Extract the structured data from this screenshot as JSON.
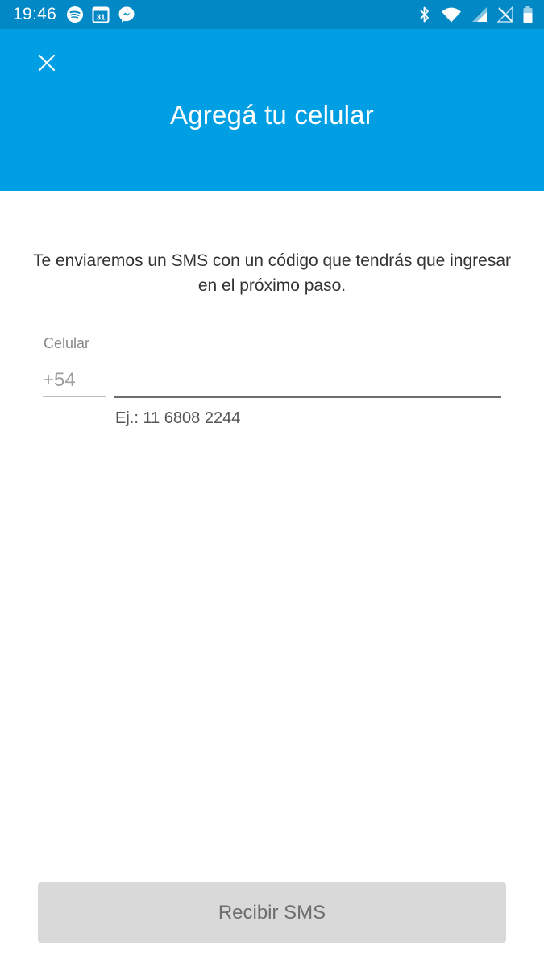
{
  "status_bar": {
    "time": "19:46",
    "calendar_day": "31",
    "left_icons": [
      "spotify-icon",
      "calendar-icon",
      "messenger-icon"
    ],
    "right_icons": [
      "bluetooth-icon",
      "wifi-icon",
      "signal-icon",
      "no-sim-icon",
      "battery-icon"
    ]
  },
  "header": {
    "title": "Agregá tu celular",
    "background_color": "#009ee3",
    "close_icon": "close-icon"
  },
  "main": {
    "instructions": "Te enviaremos un SMS con un código que tendrás que ingresar en el próximo paso.",
    "phone_field": {
      "label": "Celular",
      "country_code": "+54",
      "value": "",
      "placeholder": "",
      "hint": "Ej.: 11 6808 2244"
    }
  },
  "footer": {
    "submit_label": "Recibir SMS",
    "submit_enabled": false
  }
}
